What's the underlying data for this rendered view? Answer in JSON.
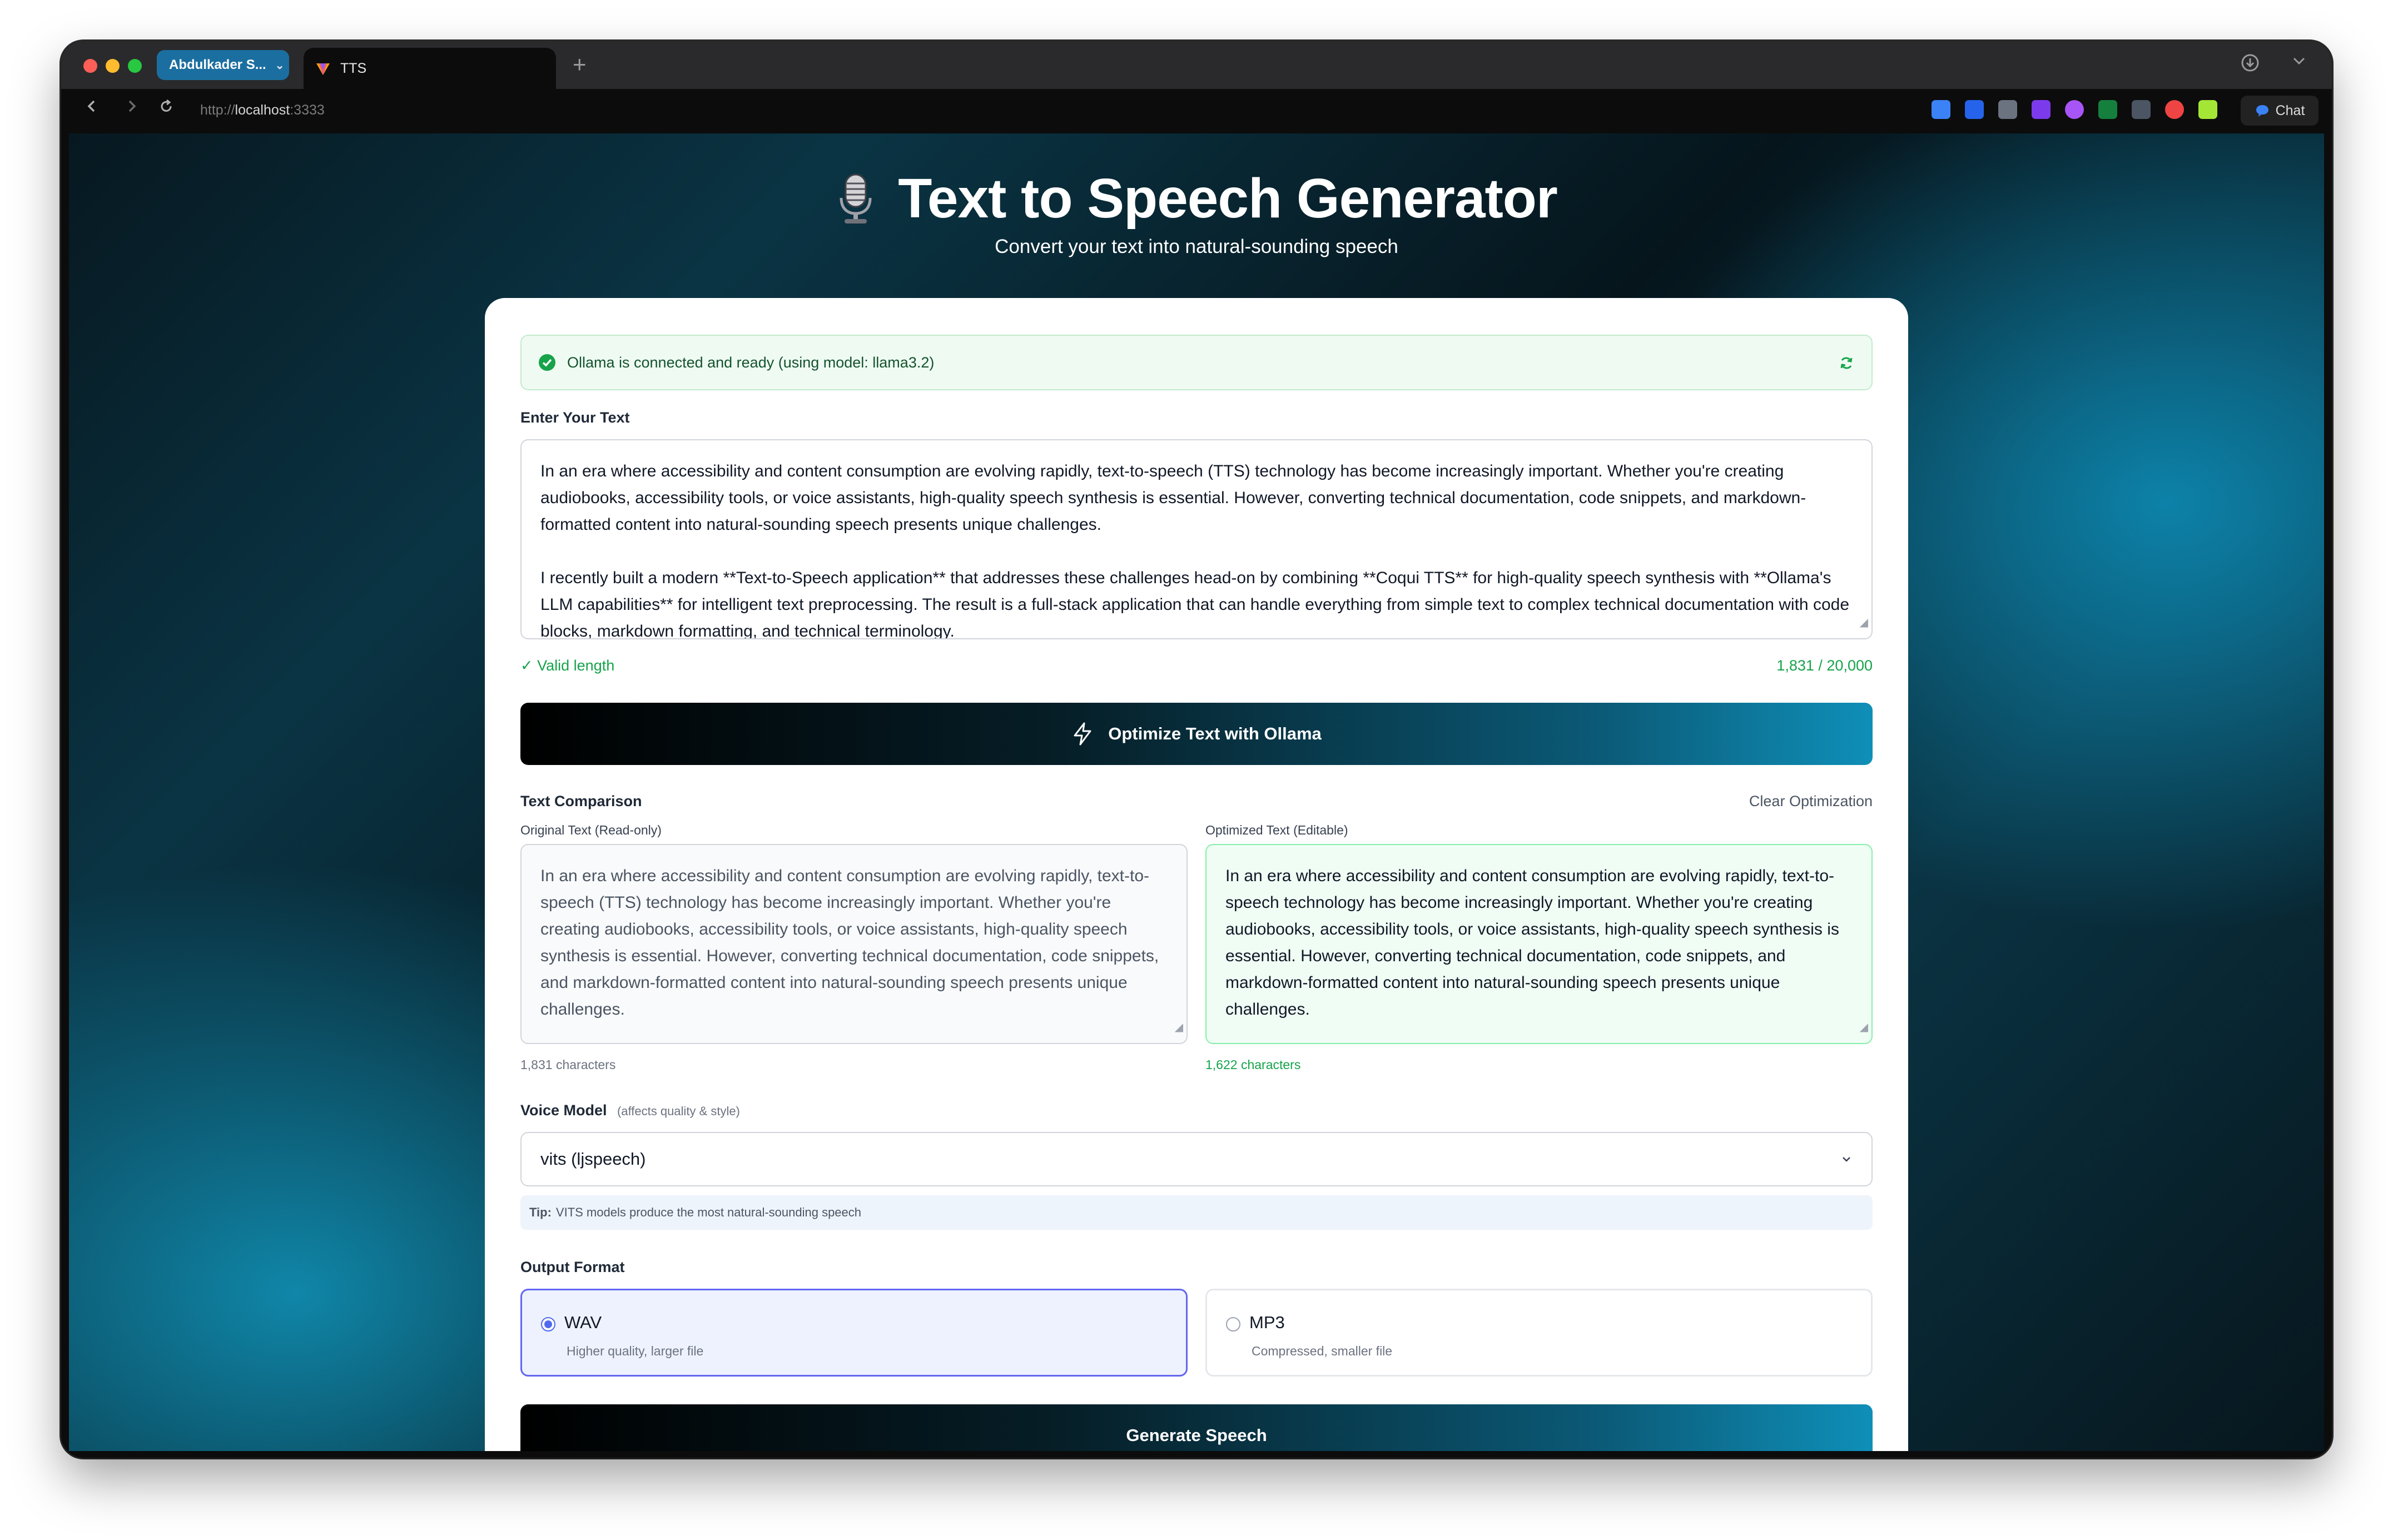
{
  "browser": {
    "tab_group_label": "Abdulkader S...",
    "active_tab_title": "TTS",
    "url_prefix": "http://",
    "url_host": "localhost",
    "url_port": ":3333",
    "chat_label": "Chat"
  },
  "header": {
    "title": "Text to Speech Generator",
    "subtitle": "Convert your text into natural-sounding speech"
  },
  "status": {
    "message": "Ollama is connected and ready (using model: llama3.2)",
    "color": "#16a34a"
  },
  "input": {
    "label": "Enter Your Text",
    "paragraphs": [
      "In an era where accessibility and content consumption are evolving rapidly, text-to-speech (TTS) technology has become increasingly important. Whether you're creating audiobooks, accessibility tools, or voice assistants, high-quality speech synthesis is essential. However, converting technical documentation, code snippets, and markdown-formatted content into natural-sounding speech presents unique challenges.",
      "I recently built a modern **Text-to-Speech application** that addresses these challenges head-on by combining **Coqui TTS** for high-quality speech synthesis with **Ollama's LLM capabilities** for intelligent text preprocessing. The result is a full-stack application that can handle everything from simple text to complex technical documentation with code blocks, markdown formatting, and technical terminology."
    ],
    "validity": "✓ Valid length",
    "count": "1,831 / 20,000"
  },
  "optimize_button": {
    "label": "Optimize Text with Ollama"
  },
  "comparison": {
    "title": "Text Comparison",
    "clear_label": "Clear Optimization",
    "original_label": "Original Text (Read-only)",
    "optimized_label": "Optimized Text (Editable)",
    "original_text": "In an era where accessibility and content consumption are evolving rapidly, text-to-speech (TTS) technology has become increasingly important. Whether you're creating audiobooks, accessibility tools, or voice assistants, high-quality speech synthesis is essential. However, converting technical documentation, code snippets, and markdown-formatted content into natural-sounding speech presents unique challenges.",
    "optimized_text": "In an era where accessibility and content consumption are evolving rapidly, text-to-speech technology has become increasingly important. Whether you're creating audiobooks, accessibility tools, or voice assistants, high-quality speech synthesis is essential. However, converting technical documentation, code snippets, and markdown-formatted content into natural-sounding speech presents unique challenges.",
    "original_count": "1,831 characters",
    "optimized_count": "1,622 characters"
  },
  "voice": {
    "label": "Voice Model",
    "hint": "(affects quality & style)",
    "selected": "vits (ljspeech)",
    "tip_bold": "Tip:",
    "tip_text": "VITS models produce the most natural-sounding speech"
  },
  "output_format": {
    "label": "Output Format",
    "options": [
      {
        "name": "WAV",
        "desc": "Higher quality, larger file",
        "selected": true
      },
      {
        "name": "MP3",
        "desc": "Compressed, smaller file",
        "selected": false
      }
    ]
  },
  "generate_button": {
    "label": "Generate Speech"
  },
  "icons": {
    "header": "microphone-icon",
    "status": "check-circle-icon",
    "refresh": "refresh-icon",
    "optimize": "lightning-icon",
    "select": "chevron-down-icon"
  },
  "colors": {
    "accent": "#4f6bed",
    "success": "#16a34a",
    "tab_group": "#1b6fa0"
  }
}
